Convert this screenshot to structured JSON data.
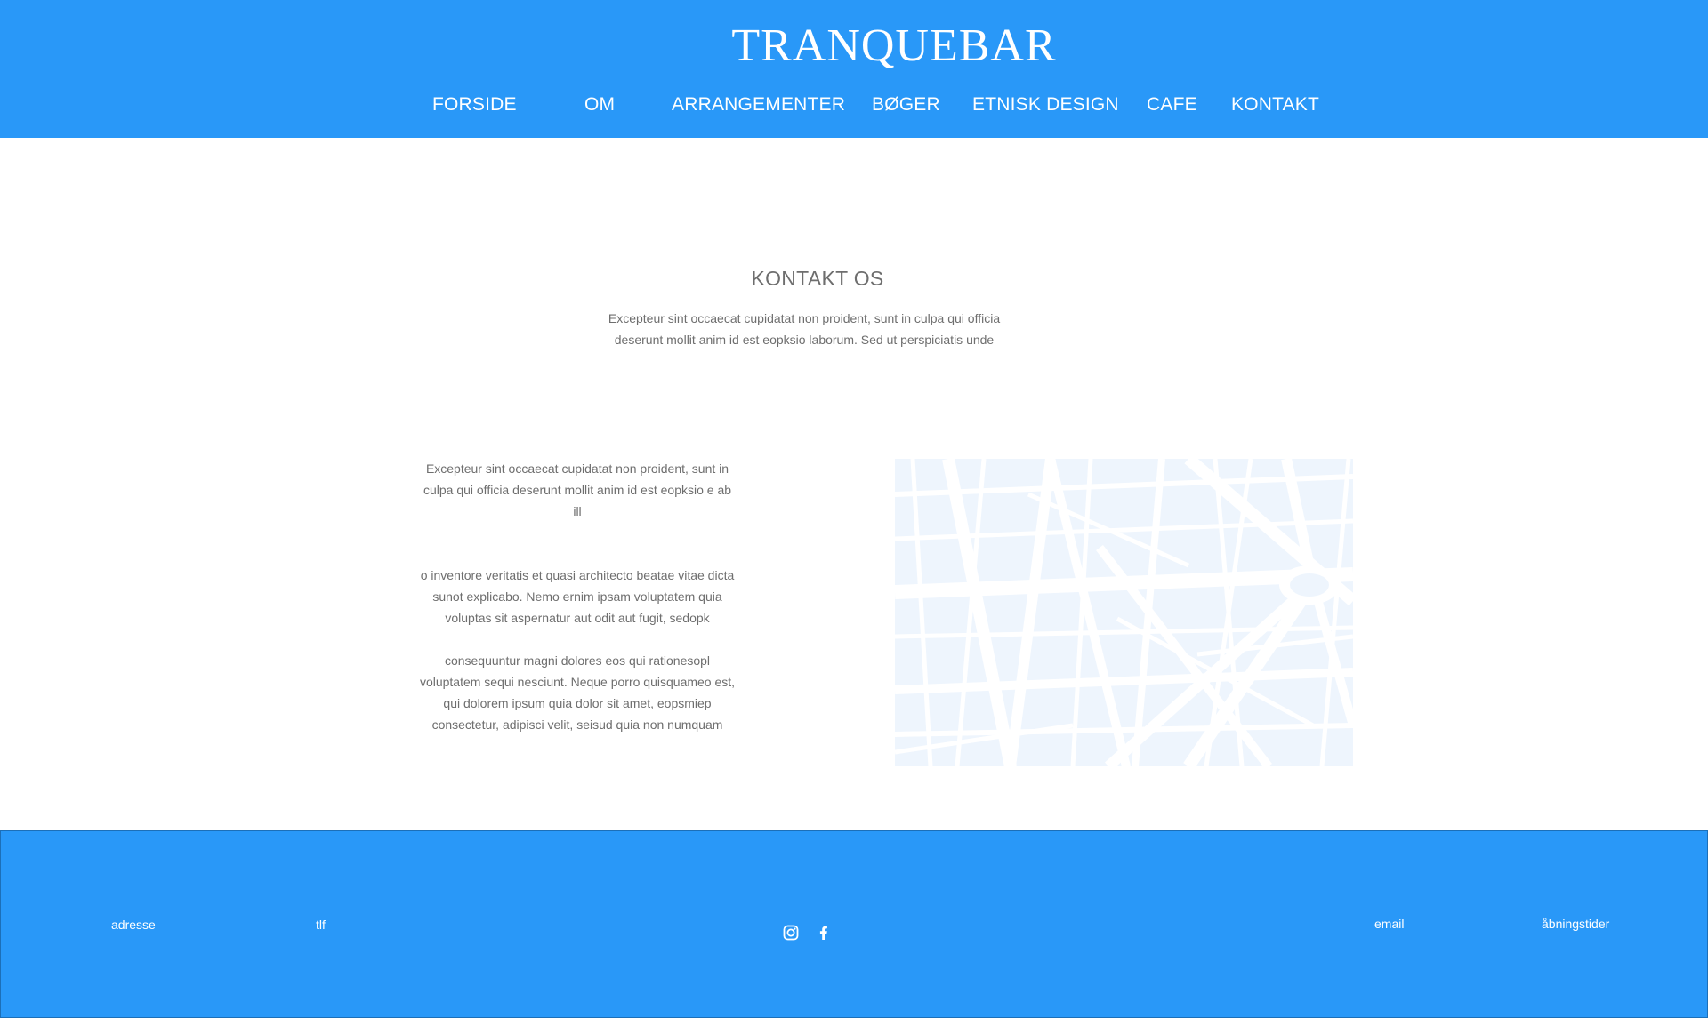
{
  "header": {
    "brand": "TRANQUEBAR",
    "nav": [
      "FORSIDE",
      "OM",
      "ARRANGEMENTER",
      "BØGER",
      "ETNISK DESIGN",
      "CAFE",
      "KONTAKT"
    ]
  },
  "contact": {
    "title": "KONTAKT OS",
    "intro": "Excepteur sint occaecat cupidatat non proident, sunt in culpa qui officia deserunt mollit anim id est eopksio laborum. Sed ut perspiciatis unde",
    "paragraphs": [
      "Excepteur sint occaecat cupidatat non proident, sunt in culpa qui officia deserunt mollit anim id est eopksio e ab ill",
      "o inventore veritatis et quasi architecto beatae vitae dicta sunot explicabo. Nemo ernim ipsam voluptatem quia voluptas sit aspernatur aut odit aut fugit, sedopk",
      "consequuntur magni dolores eos qui rationesopl voluptatem sequi nesciunt. Neque porro quisquameo est, qui dolorem ipsum quia dolor sit amet, eopsmiep consectetur, adipisci velit, seisud quia non numquam"
    ],
    "map_icon": "street-map-image"
  },
  "footer": {
    "address": "adresse",
    "phone": "tlf",
    "email": "email",
    "hours": "åbningstider",
    "social_icons": [
      "instagram-icon",
      "facebook-icon"
    ]
  },
  "colors": {
    "primary": "#2998f8",
    "text_gray": "#6e6e6e",
    "map_block": "#eef5fd",
    "white": "#ffffff"
  }
}
